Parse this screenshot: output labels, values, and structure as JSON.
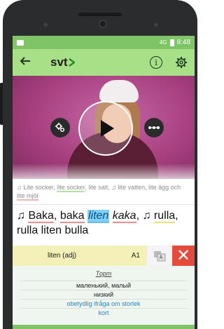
{
  "status": {
    "network": "4G",
    "time": "8:48"
  },
  "appbar": {
    "back_icon": "arrow-left-icon",
    "logo": "svt",
    "info_icon": "info-icon",
    "gear_icon": "gear-icon"
  },
  "video": {
    "settings_icon": "settings-gears-icon",
    "play_icon": "play-icon",
    "more_icon": "more-dots-icon"
  },
  "lyrics": {
    "previous": [
      "♫ Lite socker, ",
      "lite socker",
      ", lite salt, ♫ lite vatten, lite ägg och ",
      "lite mjöl"
    ],
    "current": {
      "note": "♫ ",
      "w1": "Baka",
      "sep1": ", ",
      "w2": "baka",
      "sep2": " ",
      "w3": "liten",
      "sep3": " ",
      "w4": "kaka",
      "sep4": ", ♫ ",
      "w5": "rulla",
      "sep5": ", ",
      "w6": "rulla liten bulla"
    }
  },
  "dictionary": {
    "word": "liten (adj)",
    "level": "A1",
    "part_of_speech": "Торт",
    "translations": [
      "маленький, малый",
      "низкий"
    ],
    "link_entries": [
      "obetydlig ifråga om storlek",
      "kort"
    ],
    "translate_icon": "translate-icon",
    "close_icon": "close-icon",
    "close_label": "✕"
  },
  "colors": {
    "accent_green": "#a8e088",
    "status_green": "#7fc567",
    "close_red": "#e44b3c",
    "highlight_blue": "#7fd2f7"
  }
}
